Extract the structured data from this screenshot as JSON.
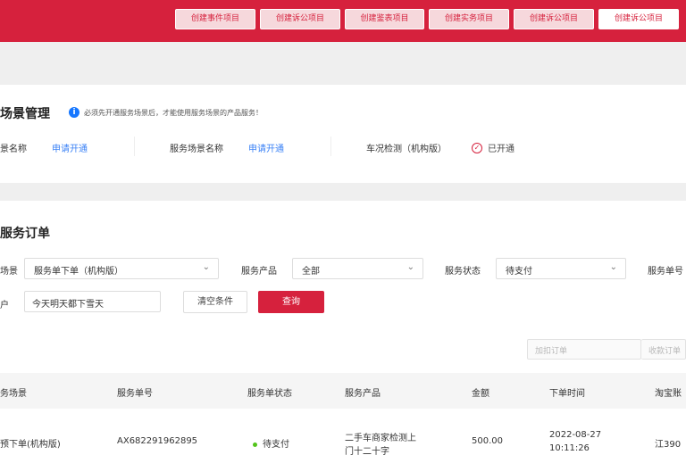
{
  "header": {
    "buttons": [
      "创建事件项目",
      "创建诉公项目",
      "创建鉴表项目",
      "创建实务项目",
      "创建诉公项目",
      "创建诉公项目"
    ]
  },
  "scene": {
    "title": "场景管理",
    "notice": "必须先开通服务场景后，才能使用服务场景的产品服务！",
    "items": [
      {
        "label": "景名称",
        "action": "申请开通"
      },
      {
        "label": "服务场景名称",
        "action": "申请开通"
      },
      {
        "label": "车况检测（机构版）",
        "status": "已开通"
      }
    ]
  },
  "orders": {
    "title": "服务订单",
    "filters": {
      "scene_label": "场景",
      "scene_value": "服务单下单（机构版）",
      "product_label": "服务产品",
      "product_value": "全部",
      "status_label": "服务状态",
      "status_value": "待支付",
      "order_no_label": "服务单号",
      "customer_label": "户",
      "customer_value": "今天明天都下雪天"
    },
    "buttons": {
      "clear": "清空条件",
      "search": "查询"
    },
    "search_placeholders": [
      "加扣订单",
      "收款订单"
    ],
    "table": {
      "headers": [
        "务场景",
        "服务单号",
        "服务单状态",
        "服务产品",
        "金额",
        "下单时间",
        "淘宝账"
      ],
      "rows": [
        {
          "scene": "预下单(机构版)",
          "order_no": "AX682291962895",
          "status": "待支付",
          "product": [
            "二手车商家检测上",
            "门十二十字"
          ],
          "amount": "500.00",
          "time": [
            "2022-08-27",
            "10:11:26"
          ],
          "account": "江390"
        }
      ]
    }
  },
  "colors": {
    "brand": "#d6213d",
    "link": "#3b82f6",
    "status_dot": "#52c41a"
  }
}
